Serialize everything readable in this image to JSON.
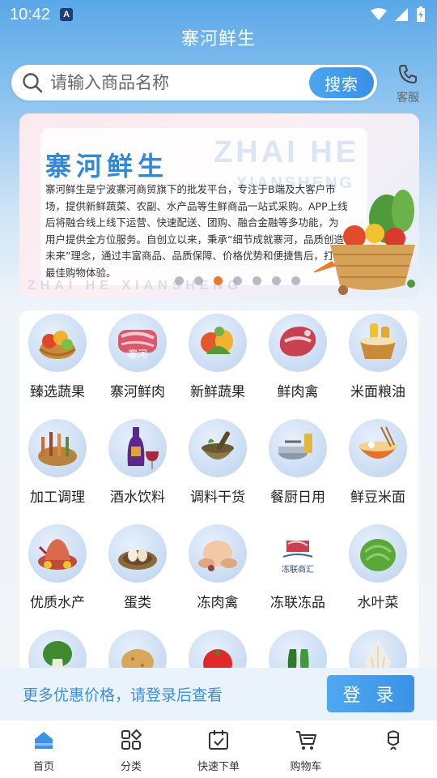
{
  "status_bar": {
    "time": "10:42",
    "app_badge": "A"
  },
  "header": {
    "title": "寨河鲜生"
  },
  "search": {
    "placeholder": "请输入商品名称",
    "button_label": "搜索"
  },
  "service": {
    "label": "客服"
  },
  "banner": {
    "title": "寨河鲜生",
    "watermark_line1": "ZHAI HE",
    "watermark_line2": "XIANSHENG",
    "bottom_watermark": "ZHAI HE XIANSHENG",
    "description": "寨河鲜生是宁波寨河商贸旗下的批发平台，专注于B端及大客户市场，提供新鲜蔬菜、农副、水产品等生鲜商品一站式采购。APP上线后将融合线上线下运营、快速配送、团购、融合金融等多功能，为用户提供全方位服务。自创立以来，秉承“细节成就寨河，品质创造未来”理念，通过丰富商品、品质保障、价格优势和便捷售后，打造最佳购物体验。",
    "page_count": 7,
    "active_page": 2
  },
  "categories": [
    {
      "label": "臻选蔬果",
      "icon": "fruit-basket-icon"
    },
    {
      "label": "寨河鲜肉",
      "icon": "fresh-meat-icon",
      "badge": "寨河"
    },
    {
      "label": "新鲜蔬果",
      "icon": "vegetables-icon"
    },
    {
      "label": "鲜肉禽",
      "icon": "meat-poultry-icon"
    },
    {
      "label": "米面粮油",
      "icon": "grain-oil-icon"
    },
    {
      "label": "加工调理",
      "icon": "processed-food-icon"
    },
    {
      "label": "酒水饮料",
      "icon": "wine-drinks-icon"
    },
    {
      "label": "调料干货",
      "icon": "seasoning-icon"
    },
    {
      "label": "餐厨日用",
      "icon": "kitchenware-icon"
    },
    {
      "label": "鲜豆米面",
      "icon": "noodles-icon"
    },
    {
      "label": "优质水产",
      "icon": "seafood-icon"
    },
    {
      "label": "蛋类",
      "icon": "eggs-icon"
    },
    {
      "label": "冻肉禽",
      "icon": "frozen-chicken-icon"
    },
    {
      "label": "冻联冻品",
      "icon": "frozen-goods-logo-icon",
      "logo_text": "冻联商汇"
    },
    {
      "label": "水叶菜",
      "icon": "leafy-greens-icon"
    },
    {
      "label": "",
      "icon": "bok-choy-icon"
    },
    {
      "label": "",
      "icon": "potato-icon"
    },
    {
      "label": "",
      "icon": "tomato-icon"
    },
    {
      "label": "",
      "icon": "pepper-icon"
    },
    {
      "label": "",
      "icon": "garlic-icon"
    }
  ],
  "login_bar": {
    "text": "更多优惠价格，请登录后查看",
    "button_label": "登 录"
  },
  "tabbar": [
    {
      "label": "首页",
      "icon": "home-icon",
      "active": true
    },
    {
      "label": "分类",
      "icon": "category-icon",
      "active": false
    },
    {
      "label": "快速下单",
      "icon": "quick-order-icon",
      "active": false
    },
    {
      "label": "购物车",
      "icon": "cart-icon",
      "active": false
    },
    {
      "label": "",
      "icon": "profile-icon",
      "active": false
    }
  ],
  "colors": {
    "accent": "#3b92e6",
    "active_dot": "#e8782c",
    "banner_title": "#2f88d8"
  }
}
